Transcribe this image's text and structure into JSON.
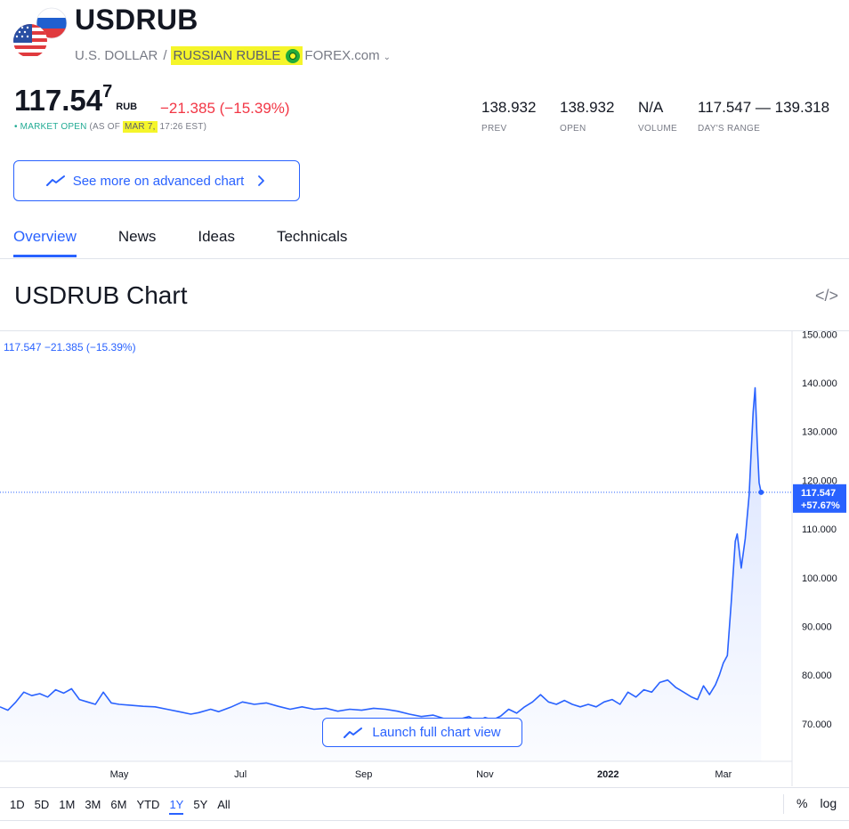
{
  "header": {
    "symbol": "USDRUB",
    "base_name": "U.S. DOLLAR",
    "separator": "/",
    "quote_name": "RUSSIAN RUBLE",
    "exchange": "FOREX.com",
    "chevron_icon": "chevron-down-icon",
    "flag_icon": "usd-rub-flags-icon"
  },
  "quote": {
    "price_main": "117.54",
    "price_last_digit": "7",
    "currency": "RUB",
    "change": "−21.385 (−15.39%)",
    "market_status": "• MARKET OPEN",
    "as_of_prefix": "(AS OF",
    "as_of_date": "MAR 7,",
    "as_of_time": "17:26 EST)"
  },
  "stats": [
    {
      "value": "138.932",
      "label": "PREV"
    },
    {
      "value": "138.932",
      "label": "OPEN"
    },
    {
      "value": "N/A",
      "label": "VOLUME"
    },
    {
      "value": "117.547 — 139.318",
      "label": "DAY'S RANGE"
    }
  ],
  "advanced_button": {
    "label": "See more on advanced chart",
    "icon": "chart-line-icon",
    "chevron": "chevron-right-icon"
  },
  "tabs": [
    {
      "label": "Overview",
      "active": true
    },
    {
      "label": "News",
      "active": false
    },
    {
      "label": "Ideas",
      "active": false
    },
    {
      "label": "Technicals",
      "active": false
    }
  ],
  "chart_section": {
    "title": "USDRUB Chart",
    "embed_icon": "embed-code-icon",
    "legend": "117.547  −21.385 (−15.39%)",
    "launch_label": "Launch full chart view",
    "launch_icon": "chart-line-icon"
  },
  "colors": {
    "accent": "#2962ff",
    "negative": "#f23645",
    "positive": "#22ab94",
    "highlight": "#f5f52a"
  },
  "chart_data": {
    "type": "area",
    "ylim": [
      62,
      152
    ],
    "yticks": [
      "150.000",
      "140.000",
      "130.000",
      "120.000",
      "110.000",
      "100.000",
      "90.000",
      "80.000",
      "70.000"
    ],
    "ytick_values": [
      150,
      140,
      130,
      120,
      110,
      100,
      90,
      80,
      70
    ],
    "xticks": [
      {
        "label": "May",
        "x": 60
      },
      {
        "label": "Jul",
        "x": 121
      },
      {
        "label": "Sep",
        "x": 183
      },
      {
        "label": "Nov",
        "x": 244
      },
      {
        "label": "2022",
        "x": 306,
        "bold": true
      },
      {
        "label": "Mar",
        "x": 364
      }
    ],
    "xlim": [
      0,
      390
    ],
    "last_price_label": "117.547",
    "last_change_label": "+57.67%",
    "last_value": 117.547,
    "points": [
      [
        0,
        73.5
      ],
      [
        4,
        72.8
      ],
      [
        8,
        74.5
      ],
      [
        12,
        76.5
      ],
      [
        16,
        75.8
      ],
      [
        20,
        76.2
      ],
      [
        24,
        75.5
      ],
      [
        28,
        77.0
      ],
      [
        32,
        76.3
      ],
      [
        36,
        77.2
      ],
      [
        40,
        75.0
      ],
      [
        44,
        74.5
      ],
      [
        48,
        74.0
      ],
      [
        52,
        76.5
      ],
      [
        56,
        74.3
      ],
      [
        60,
        74.0
      ],
      [
        66,
        73.8
      ],
      [
        72,
        73.6
      ],
      [
        78,
        73.5
      ],
      [
        84,
        73.0
      ],
      [
        90,
        72.5
      ],
      [
        96,
        72.0
      ],
      [
        100,
        72.3
      ],
      [
        106,
        73.0
      ],
      [
        110,
        72.5
      ],
      [
        116,
        73.4
      ],
      [
        122,
        74.5
      ],
      [
        128,
        74.0
      ],
      [
        134,
        74.3
      ],
      [
        140,
        73.6
      ],
      [
        146,
        73.0
      ],
      [
        152,
        73.5
      ],
      [
        158,
        73.0
      ],
      [
        164,
        73.2
      ],
      [
        170,
        72.6
      ],
      [
        176,
        73.0
      ],
      [
        182,
        72.8
      ],
      [
        188,
        73.2
      ],
      [
        194,
        73.0
      ],
      [
        200,
        72.6
      ],
      [
        206,
        72.0
      ],
      [
        212,
        71.5
      ],
      [
        218,
        71.8
      ],
      [
        224,
        71.0
      ],
      [
        230,
        70.8
      ],
      [
        236,
        71.5
      ],
      [
        240,
        70.5
      ],
      [
        244,
        71.3
      ],
      [
        248,
        70.8
      ],
      [
        252,
        71.6
      ],
      [
        256,
        73.0
      ],
      [
        260,
        72.2
      ],
      [
        264,
        73.5
      ],
      [
        268,
        74.5
      ],
      [
        272,
        76.0
      ],
      [
        276,
        74.5
      ],
      [
        280,
        74.0
      ],
      [
        284,
        74.8
      ],
      [
        288,
        74.0
      ],
      [
        292,
        73.5
      ],
      [
        296,
        74.0
      ],
      [
        300,
        73.5
      ],
      [
        304,
        74.5
      ],
      [
        308,
        75.0
      ],
      [
        312,
        74.0
      ],
      [
        316,
        76.5
      ],
      [
        320,
        75.5
      ],
      [
        324,
        77.0
      ],
      [
        328,
        76.5
      ],
      [
        332,
        78.5
      ],
      [
        336,
        79.0
      ],
      [
        340,
        77.5
      ],
      [
        344,
        76.5
      ],
      [
        348,
        75.5
      ],
      [
        351,
        75.0
      ],
      [
        354,
        77.8
      ],
      [
        357,
        76.0
      ],
      [
        360,
        78.0
      ],
      [
        362,
        80.0
      ],
      [
        364,
        82.5
      ],
      [
        366,
        84.0
      ],
      [
        368,
        95.0
      ],
      [
        370,
        107.5
      ],
      [
        371,
        109.0
      ],
      [
        372,
        105.5
      ],
      [
        373,
        102.0
      ],
      [
        375,
        108.0
      ],
      [
        377,
        117.0
      ],
      [
        378,
        126.0
      ],
      [
        379,
        134.0
      ],
      [
        380,
        139.0
      ],
      [
        381,
        128.0
      ],
      [
        382,
        119.5
      ],
      [
        383,
        117.547
      ]
    ]
  },
  "range_buttons": [
    {
      "label": "1D",
      "active": false
    },
    {
      "label": "5D",
      "active": false
    },
    {
      "label": "1M",
      "active": false
    },
    {
      "label": "3M",
      "active": false
    },
    {
      "label": "6M",
      "active": false
    },
    {
      "label": "YTD",
      "active": false
    },
    {
      "label": "1Y",
      "active": true
    },
    {
      "label": "5Y",
      "active": false
    },
    {
      "label": "All",
      "active": false
    }
  ],
  "scale_options": {
    "percent": "%",
    "log": "log"
  }
}
